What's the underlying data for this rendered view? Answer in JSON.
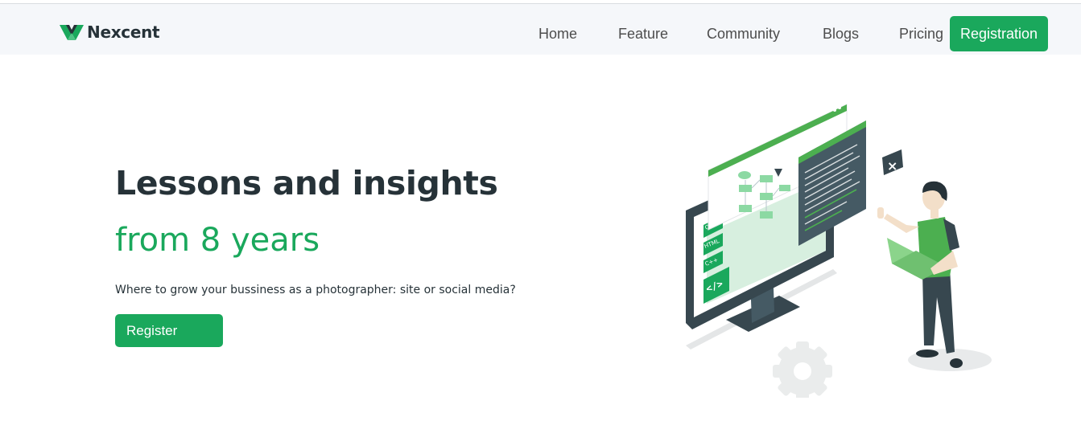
{
  "brand": {
    "name": "Nexcent",
    "logo_icon": "nexcent-logo-icon",
    "accent_color": "#1aa85c",
    "dark_color": "#263238"
  },
  "nav": {
    "items": [
      {
        "label": "Home"
      },
      {
        "label": "Feature"
      },
      {
        "label": "Community"
      },
      {
        "label": "Blogs"
      },
      {
        "label": "Pricing"
      }
    ],
    "cta_label": "Registration"
  },
  "hero": {
    "title": "Lessons and insights",
    "subtitle": "from 8 years",
    "description": "Where to grow your bussiness as a photographer: site or social media?",
    "button_label": "Register",
    "illustration": {
      "icon": "developer-with-laptop-illustration",
      "code_tags": [
        "CSS",
        "HTML",
        "C++"
      ]
    }
  }
}
